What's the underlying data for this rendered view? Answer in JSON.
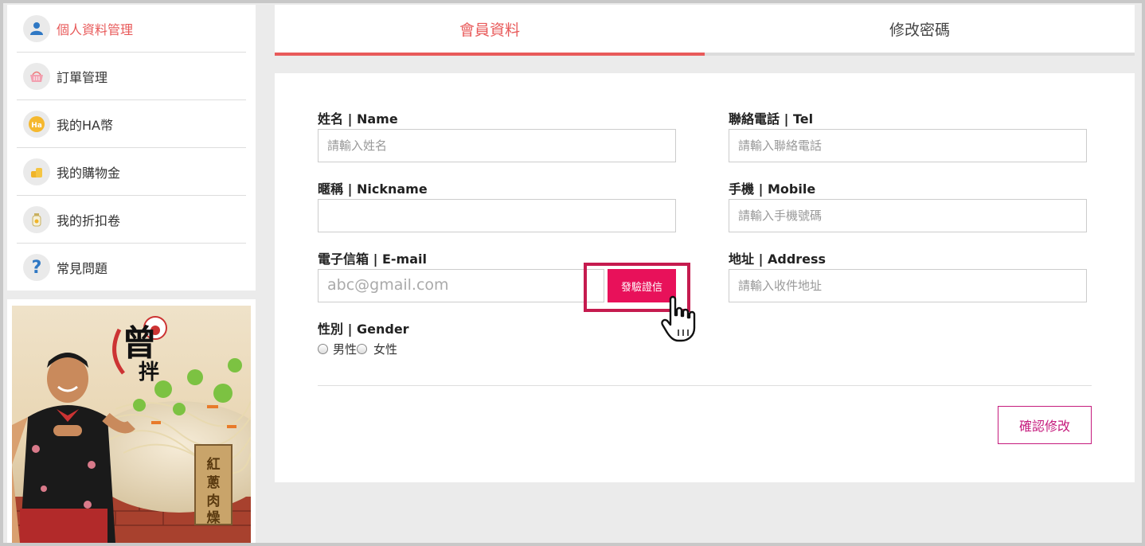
{
  "sidebar": {
    "items": [
      {
        "label": "個人資料管理",
        "icon": "user-icon"
      },
      {
        "label": "訂單管理",
        "icon": "basket-icon"
      },
      {
        "label": "我的HA幣",
        "icon": "ha-coin-icon",
        "icon_text": "Ha"
      },
      {
        "label": "我的購物金",
        "icon": "coins-icon"
      },
      {
        "label": "我的折扣卷",
        "icon": "discount-jar-icon"
      },
      {
        "label": "常見問題",
        "icon": "question-icon",
        "icon_text": "?"
      }
    ]
  },
  "promo": {
    "image": "promo-banner-image",
    "brand_text": "曾拌",
    "product_text": "紅蔥肉燥"
  },
  "tabs": [
    {
      "label": "會員資料",
      "active": true
    },
    {
      "label": "修改密碼",
      "active": false
    }
  ],
  "form": {
    "name": {
      "label": "姓名 | Name",
      "placeholder": "請輸入姓名",
      "value": ""
    },
    "nickname": {
      "label": "暱稱 | Nickname",
      "placeholder": "",
      "value": ""
    },
    "email": {
      "label": "電子信箱 | E-mail",
      "placeholder": "abc@gmail.com",
      "value": ""
    },
    "verify_button": "發驗證信",
    "gender": {
      "label": "性別 | Gender",
      "options": [
        "男性",
        "女性"
      ]
    },
    "tel": {
      "label": "聯絡電話 | Tel",
      "placeholder": "請輸入聯絡電話",
      "value": ""
    },
    "mobile": {
      "label": "手機 | Mobile",
      "placeholder": "請輸入手機號碼",
      "value": ""
    },
    "address": {
      "label": "地址 | Address",
      "placeholder": "請輸入收件地址",
      "value": ""
    },
    "confirm_button": "確認修改"
  },
  "colors": {
    "accent": "#e85a5a",
    "verify": "#e8115a",
    "highlight": "#c51b4f",
    "confirm": "#c51b7d"
  }
}
